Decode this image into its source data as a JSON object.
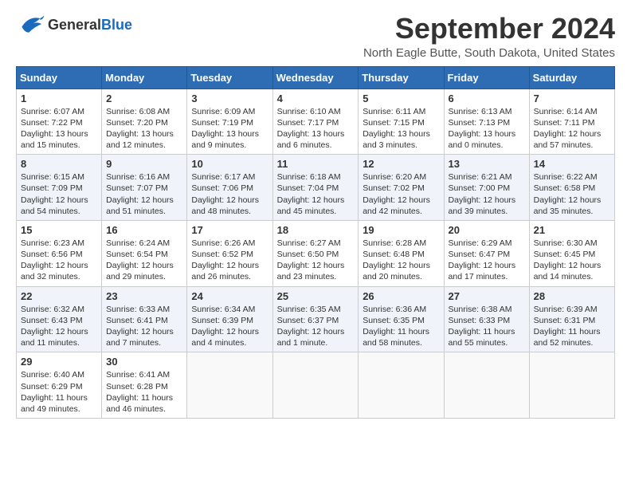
{
  "logo": {
    "line1": "General",
    "line2": "Blue"
  },
  "title": "September 2024",
  "location": "North Eagle Butte, South Dakota, United States",
  "days_of_week": [
    "Sunday",
    "Monday",
    "Tuesday",
    "Wednesday",
    "Thursday",
    "Friday",
    "Saturday"
  ],
  "weeks": [
    [
      {
        "day": "1",
        "info": "Sunrise: 6:07 AM\nSunset: 7:22 PM\nDaylight: 13 hours\nand 15 minutes."
      },
      {
        "day": "2",
        "info": "Sunrise: 6:08 AM\nSunset: 7:20 PM\nDaylight: 13 hours\nand 12 minutes."
      },
      {
        "day": "3",
        "info": "Sunrise: 6:09 AM\nSunset: 7:19 PM\nDaylight: 13 hours\nand 9 minutes."
      },
      {
        "day": "4",
        "info": "Sunrise: 6:10 AM\nSunset: 7:17 PM\nDaylight: 13 hours\nand 6 minutes."
      },
      {
        "day": "5",
        "info": "Sunrise: 6:11 AM\nSunset: 7:15 PM\nDaylight: 13 hours\nand 3 minutes."
      },
      {
        "day": "6",
        "info": "Sunrise: 6:13 AM\nSunset: 7:13 PM\nDaylight: 13 hours\nand 0 minutes."
      },
      {
        "day": "7",
        "info": "Sunrise: 6:14 AM\nSunset: 7:11 PM\nDaylight: 12 hours\nand 57 minutes."
      }
    ],
    [
      {
        "day": "8",
        "info": "Sunrise: 6:15 AM\nSunset: 7:09 PM\nDaylight: 12 hours\nand 54 minutes."
      },
      {
        "day": "9",
        "info": "Sunrise: 6:16 AM\nSunset: 7:07 PM\nDaylight: 12 hours\nand 51 minutes."
      },
      {
        "day": "10",
        "info": "Sunrise: 6:17 AM\nSunset: 7:06 PM\nDaylight: 12 hours\nand 48 minutes."
      },
      {
        "day": "11",
        "info": "Sunrise: 6:18 AM\nSunset: 7:04 PM\nDaylight: 12 hours\nand 45 minutes."
      },
      {
        "day": "12",
        "info": "Sunrise: 6:20 AM\nSunset: 7:02 PM\nDaylight: 12 hours\nand 42 minutes."
      },
      {
        "day": "13",
        "info": "Sunrise: 6:21 AM\nSunset: 7:00 PM\nDaylight: 12 hours\nand 39 minutes."
      },
      {
        "day": "14",
        "info": "Sunrise: 6:22 AM\nSunset: 6:58 PM\nDaylight: 12 hours\nand 35 minutes."
      }
    ],
    [
      {
        "day": "15",
        "info": "Sunrise: 6:23 AM\nSunset: 6:56 PM\nDaylight: 12 hours\nand 32 minutes."
      },
      {
        "day": "16",
        "info": "Sunrise: 6:24 AM\nSunset: 6:54 PM\nDaylight: 12 hours\nand 29 minutes."
      },
      {
        "day": "17",
        "info": "Sunrise: 6:26 AM\nSunset: 6:52 PM\nDaylight: 12 hours\nand 26 minutes."
      },
      {
        "day": "18",
        "info": "Sunrise: 6:27 AM\nSunset: 6:50 PM\nDaylight: 12 hours\nand 23 minutes."
      },
      {
        "day": "19",
        "info": "Sunrise: 6:28 AM\nSunset: 6:48 PM\nDaylight: 12 hours\nand 20 minutes."
      },
      {
        "day": "20",
        "info": "Sunrise: 6:29 AM\nSunset: 6:47 PM\nDaylight: 12 hours\nand 17 minutes."
      },
      {
        "day": "21",
        "info": "Sunrise: 6:30 AM\nSunset: 6:45 PM\nDaylight: 12 hours\nand 14 minutes."
      }
    ],
    [
      {
        "day": "22",
        "info": "Sunrise: 6:32 AM\nSunset: 6:43 PM\nDaylight: 12 hours\nand 11 minutes."
      },
      {
        "day": "23",
        "info": "Sunrise: 6:33 AM\nSunset: 6:41 PM\nDaylight: 12 hours\nand 7 minutes."
      },
      {
        "day": "24",
        "info": "Sunrise: 6:34 AM\nSunset: 6:39 PM\nDaylight: 12 hours\nand 4 minutes."
      },
      {
        "day": "25",
        "info": "Sunrise: 6:35 AM\nSunset: 6:37 PM\nDaylight: 12 hours\nand 1 minute."
      },
      {
        "day": "26",
        "info": "Sunrise: 6:36 AM\nSunset: 6:35 PM\nDaylight: 11 hours\nand 58 minutes."
      },
      {
        "day": "27",
        "info": "Sunrise: 6:38 AM\nSunset: 6:33 PM\nDaylight: 11 hours\nand 55 minutes."
      },
      {
        "day": "28",
        "info": "Sunrise: 6:39 AM\nSunset: 6:31 PM\nDaylight: 11 hours\nand 52 minutes."
      }
    ],
    [
      {
        "day": "29",
        "info": "Sunrise: 6:40 AM\nSunset: 6:29 PM\nDaylight: 11 hours\nand 49 minutes."
      },
      {
        "day": "30",
        "info": "Sunrise: 6:41 AM\nSunset: 6:28 PM\nDaylight: 11 hours\nand 46 minutes."
      },
      {
        "day": "",
        "info": ""
      },
      {
        "day": "",
        "info": ""
      },
      {
        "day": "",
        "info": ""
      },
      {
        "day": "",
        "info": ""
      },
      {
        "day": "",
        "info": ""
      }
    ]
  ]
}
